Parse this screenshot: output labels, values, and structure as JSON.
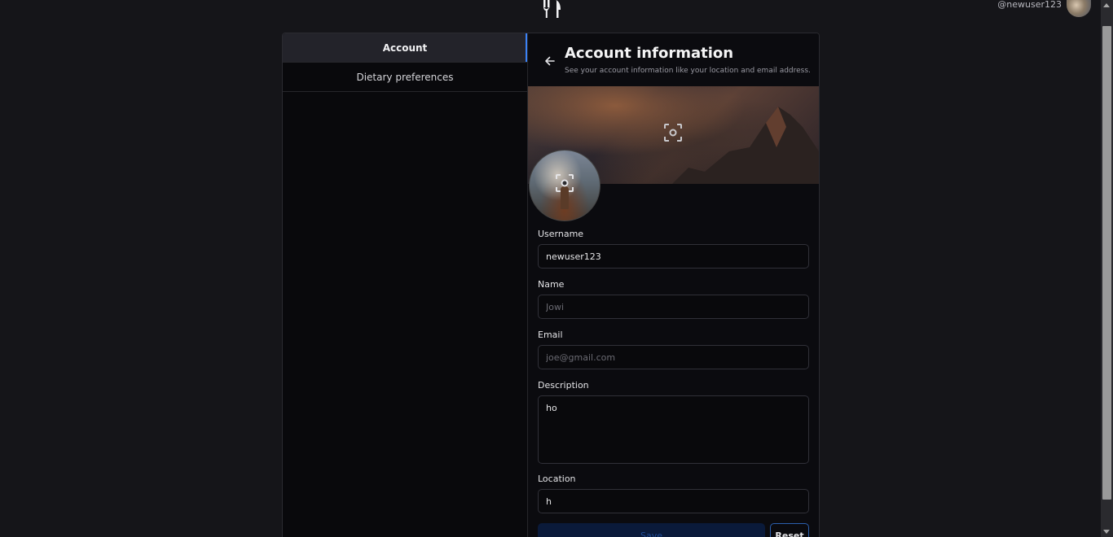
{
  "header": {
    "logo_icon": "fork-knife-icon",
    "username_handle": "@newuser123"
  },
  "sidebar": {
    "items": [
      {
        "label": "Account",
        "active": true
      },
      {
        "label": "Dietary preferences",
        "active": false
      }
    ]
  },
  "account": {
    "title": "Account information",
    "subtitle": "See your account information like your location and email address."
  },
  "form": {
    "username": {
      "label": "Username",
      "value": "newuser123",
      "placeholder": ""
    },
    "name": {
      "label": "Name",
      "value": "",
      "placeholder": "Jowi"
    },
    "email": {
      "label": "Email",
      "value": "",
      "placeholder": "joe@gmail.com"
    },
    "description": {
      "label": "Description",
      "value": "ho"
    },
    "location": {
      "label": "Location",
      "value": "h"
    }
  },
  "buttons": {
    "save": "Save",
    "reset": "Reset"
  },
  "colors": {
    "background": "#151519",
    "panel": "#0b0b0f",
    "accent": "#3b82f6",
    "save_bg": "#0a1a3a"
  }
}
